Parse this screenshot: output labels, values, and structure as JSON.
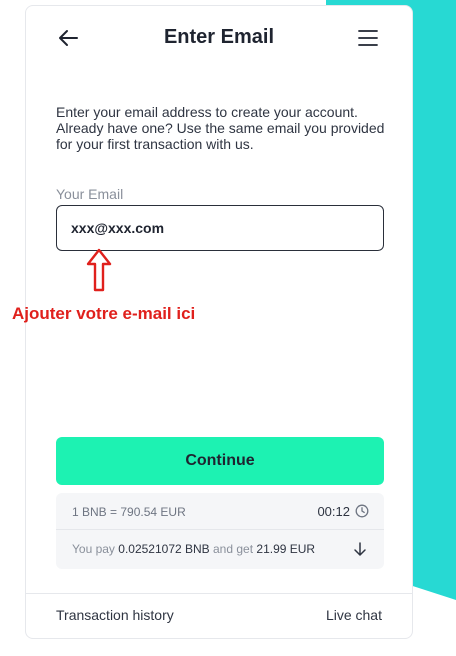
{
  "header": {
    "title": "Enter Email"
  },
  "intro": {
    "text": "Enter your email address to create your account. Already have one? Use the same email you provided for your first transaction with us."
  },
  "email": {
    "label": "Your Email",
    "value": "xxx@xxx.com"
  },
  "annotation": {
    "text": "Ajouter votre e-mail ici"
  },
  "actions": {
    "continue_label": "Continue"
  },
  "rate": {
    "text": "1 BNB = 790.54 EUR",
    "timer": "00:12"
  },
  "payment": {
    "prefix": "You pay ",
    "pay_amount": "0.02521072 BNB",
    "middle": " and get ",
    "get_amount": "21.99 EUR"
  },
  "footer": {
    "history_label": "Transaction history",
    "chat_label": "Live chat"
  },
  "colors": {
    "accent": "#1df2b2",
    "background_teal": "#27d9d3",
    "annotation_red": "#e0201c"
  },
  "icons": {
    "back": "arrow-left-icon",
    "menu": "hamburger-menu-icon",
    "timer": "clock-icon",
    "expand": "arrow-down-icon",
    "annotation": "red-up-arrow-icon"
  }
}
